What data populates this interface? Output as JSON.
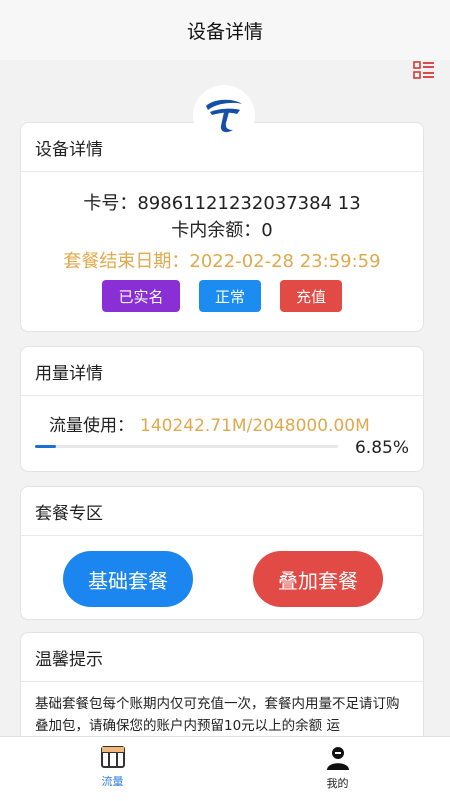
{
  "header": {
    "title": "设备详情"
  },
  "device_card": {
    "title": "设备详情",
    "card_number": "卡号：89861121232037384 13",
    "balance": "卡内余额：0",
    "end_date": "套餐结束日期：2022-02-28 23:59:59",
    "badges": [
      "已实名",
      "正常",
      "充值"
    ]
  },
  "usage_card": {
    "title": "用量详情",
    "label": "流量使用：",
    "value": "140242.71M/2048000.00M",
    "percent_text": "6.85%",
    "percent": 6.85
  },
  "package_card": {
    "title": "套餐专区",
    "basic": "基础套餐",
    "addon": "叠加套餐"
  },
  "tips_card": {
    "title": "温馨提示",
    "text": "基础套餐包每个账期内仅可充值一次，套餐内用量不足请订购叠加包，请确保您的账户内预留10元以上的余额 运"
  },
  "tabs": [
    {
      "label": "流量",
      "icon": "data-usage-icon",
      "active": true
    },
    {
      "label": "我的",
      "icon": "user-icon",
      "active": false
    }
  ],
  "colors": {
    "accent": "#1d8cf0",
    "warning": "#e0a94d",
    "purple": "#8a2fd6",
    "red": "#e24a45"
  }
}
